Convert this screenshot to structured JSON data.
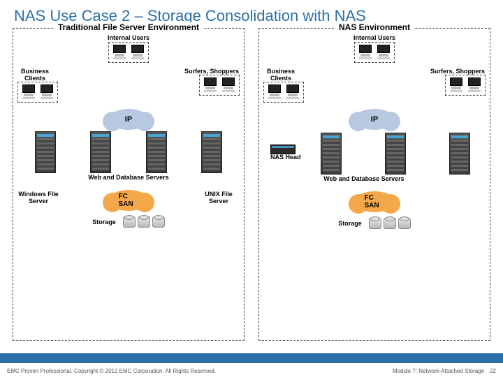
{
  "title": "NAS Use Case 2 – Storage Consolidation with NAS",
  "left": {
    "title": "Traditional File Server Environment",
    "internal": "Internal Users",
    "business": "Business Clients",
    "surfers": "Surfers, Shoppers",
    "ip": "IP",
    "wds": "Web and Database Servers",
    "win": "Windows File Server",
    "unix": "UNIX File Server",
    "fcsan": "FC SAN",
    "storage": "Storage"
  },
  "right": {
    "title": "NAS Environment",
    "internal": "Internal Users",
    "business": "Business Clients",
    "surfers": "Surfers, Shoppers",
    "ip": "IP",
    "nas_head": "NAS Head",
    "wds": "Web and Database Servers",
    "fcsan": "FC SAN",
    "storage": "Storage"
  },
  "footer": {
    "left": "EMC Proven Professional. Copyright © 2012 EMC Corporation. All Rights Reserved.",
    "module": "Module 7: Network-Attached Storage",
    "page": "22"
  }
}
